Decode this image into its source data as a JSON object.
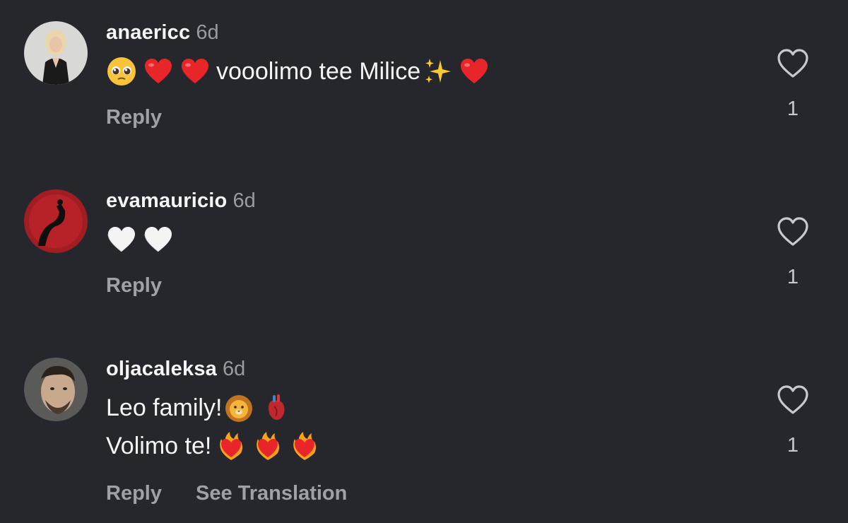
{
  "comments": [
    {
      "username": "anaericc",
      "time": "6d",
      "lines": [
        {
          "before_emojis": [
            "pleading-face",
            "red-heart",
            "red-heart"
          ],
          "text": "vooolimo tee Milice",
          "after_emojis": [
            "sparkles",
            "red-heart"
          ]
        }
      ],
      "actions": [
        "Reply"
      ],
      "like_count": "1"
    },
    {
      "username": "evamauricio",
      "time": "6d",
      "lines": [
        {
          "before_emojis": [
            "white-heart",
            "white-heart"
          ],
          "text": "",
          "after_emojis": []
        }
      ],
      "actions": [
        "Reply"
      ],
      "like_count": "1"
    },
    {
      "username": "oljacaleksa",
      "time": "6d",
      "lines": [
        {
          "before_emojis": [],
          "text": "Leo family!",
          "after_emojis": [
            "lion-face",
            "anatomical-heart"
          ]
        },
        {
          "before_emojis": [],
          "text": "Volimo te!",
          "after_emojis": [
            "heart-on-fire",
            "heart-on-fire",
            "heart-on-fire"
          ]
        }
      ],
      "actions": [
        "Reply",
        "See Translation"
      ],
      "like_count": "1"
    }
  ],
  "colors": {
    "background": "#26272c",
    "username": "#f5f5f5",
    "timestamp": "#9a9ba1",
    "action": "#a0a1a7",
    "like_icon": "#c8c9ce"
  },
  "icons": {
    "like": "heart-outline-icon"
  }
}
